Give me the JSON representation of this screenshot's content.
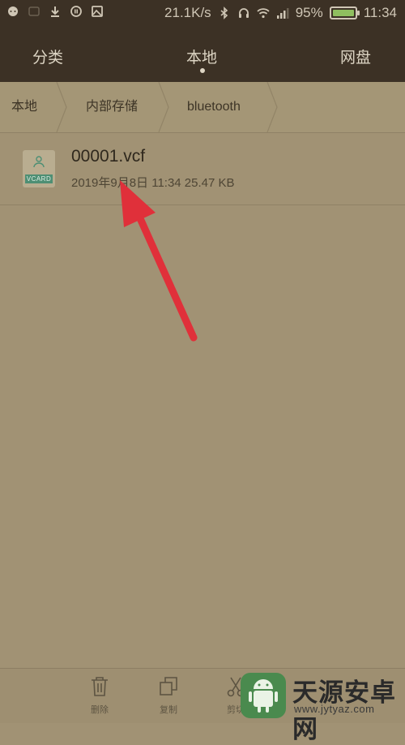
{
  "status_bar": {
    "network_speed": "21.1K/s",
    "battery_percent": "95%",
    "time": "11:34",
    "left_icons": [
      "message-icon",
      "app-icon",
      "download-icon",
      "media-icon",
      "image-icon"
    ],
    "right_icons": [
      "bluetooth-icon",
      "headset-icon",
      "wifi-icon",
      "signal-icon",
      "battery-icon"
    ]
  },
  "tabs": [
    {
      "label": "分类"
    },
    {
      "label": "本地"
    },
    {
      "label": "网盘"
    }
  ],
  "active_tab": "本地",
  "breadcrumb": [
    {
      "label": "本地"
    },
    {
      "label": "内部存储"
    },
    {
      "label": "bluetooth"
    }
  ],
  "files": [
    {
      "name": "00001.vcf",
      "meta": "2019年9月8日 11:34 25.47 KB",
      "icon": "vcard-file-icon",
      "icon_tag": "VCARD"
    }
  ],
  "bottom_actions": [
    {
      "label": "删除",
      "icon": "trash-icon"
    },
    {
      "label": "复制",
      "icon": "copy-icon"
    },
    {
      "label": "剪切",
      "icon": "scissors-icon"
    }
  ],
  "watermark": {
    "name": "天源安卓网",
    "url": "www.jytyaz.com"
  },
  "colors": {
    "top_band": "#3c3125",
    "background": "#a19274",
    "annotation_arrow": "#e0303a",
    "watermark_green": "#4a8a4e"
  }
}
